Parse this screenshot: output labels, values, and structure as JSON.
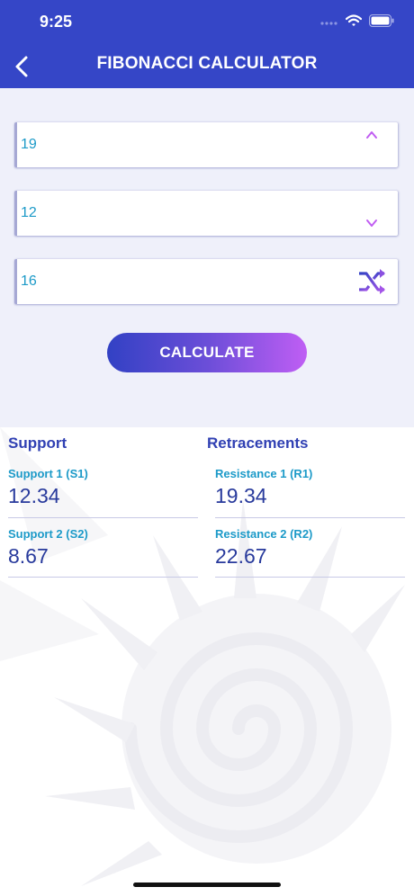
{
  "status_bar": {
    "time": "9:25"
  },
  "header": {
    "title": "FIBONACCI CALCULATOR",
    "back_icon": "chevron-left-icon"
  },
  "inputs": [
    {
      "value": "19",
      "icon": "arrow-up-icon"
    },
    {
      "value": "12",
      "icon": "arrow-down-icon"
    },
    {
      "value": "16",
      "icon": "shuffle-icon"
    }
  ],
  "calculate_label": "CALCULATE",
  "support": {
    "title": "Support",
    "items": [
      {
        "label": "Support 1 (S1)",
        "value": "12.34"
      },
      {
        "label": "Support 2 (S2)",
        "value": "8.67"
      }
    ]
  },
  "retracements": {
    "title": "Retracements",
    "items": [
      {
        "label": "Resistance 1 (R1)",
        "value": "19.34"
      },
      {
        "label": "Resistance 2 (R2)",
        "value": "22.67"
      }
    ]
  },
  "colors": {
    "header": "#3546c7",
    "accent_text": "#1c9ac8",
    "value_text": "#283a9c",
    "gradient_start": "#3241c4",
    "gradient_end": "#bf5ef4"
  }
}
